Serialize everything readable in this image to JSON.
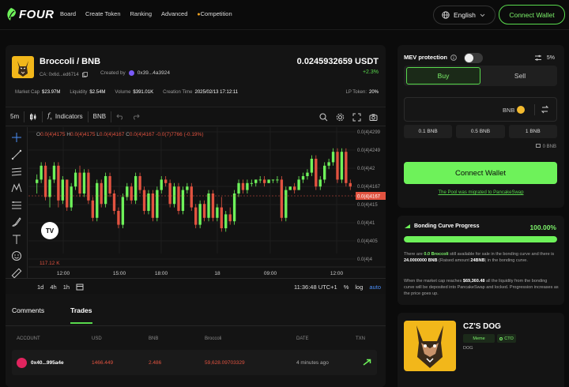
{
  "app": {
    "logo_text": "FOUR"
  },
  "nav": {
    "items": [
      "Board",
      "Create Token",
      "Ranking",
      "Advanced",
      "Competition"
    ]
  },
  "header": {
    "language": "English",
    "connect_wallet": "Connect Wallet"
  },
  "token": {
    "pair": "Broccoli / BNB",
    "ca_label": "CA: 0x6d...ed6714",
    "created_by_label": "Created by",
    "creator": "0x39...4a3924",
    "price": "0.0245932659 USDT",
    "change": "+2.3%",
    "stats": [
      {
        "label": "Market Cap",
        "value": "$23.97M"
      },
      {
        "label": "Liquidity",
        "value": "$2.54M"
      },
      {
        "label": "Volume",
        "value": "$391.01K"
      },
      {
        "label": "Creation Time",
        "value": "2025/02/13 17:12:11"
      }
    ],
    "lp_label": "LP Token:",
    "lp_value": "20%"
  },
  "chart_toolbar": {
    "interval": "5m",
    "indicators": "Indicators",
    "symbol": "BNB"
  },
  "chart_data": {
    "type": "candlestick",
    "ohlc_readout": {
      "o": "0.0(4)4175",
      "h": "0.0(4)4175",
      "l": "0.0(4)4167",
      "c": "0.0(4)4167",
      "chg": "-0.0(7)7766 (-0.19%)"
    },
    "y_tick_labels": [
      "0.0(4)4299",
      "0.0(4)4249",
      "0.0(4)42",
      "0.0(4)4167",
      "0.0(4)415",
      "0.0(4)41",
      "0.0(4)405",
      "0.0(4)4"
    ],
    "last_price_label": "0.0(4)4167",
    "x_tick_labels": [
      "12:00",
      "15:00",
      "18:00",
      "18",
      "09:00",
      "12:00"
    ],
    "volume_label": "117.12 K",
    "candles": [
      [
        4.18e-05,
        4.205e-05,
        4.15e-05,
        4.19e-05
      ],
      [
        4.19e-05,
        4.24e-05,
        4.18e-05,
        4.23e-05
      ],
      [
        4.23e-05,
        4.24e-05,
        4.13e-05,
        4.14e-05
      ],
      [
        4.14e-05,
        4.2e-05,
        4.11e-05,
        4.19e-05
      ],
      [
        4.19e-05,
        4.24e-05,
        4.18e-05,
        4.23e-05
      ],
      [
        4.23e-05,
        4.24e-05,
        4.11e-05,
        4.13e-05
      ],
      [
        4.13e-05,
        4.2e-05,
        4.12e-05,
        4.19e-05
      ],
      [
        4.19e-05,
        4.19e-05,
        4.1e-05,
        4.11e-05
      ],
      [
        4.11e-05,
        4.18e-05,
        4.1e-05,
        4.17e-05
      ],
      [
        4.17e-05,
        4.22e-05,
        4.16e-05,
        4.21e-05
      ],
      [
        4.21e-05,
        4.23e-05,
        4.14e-05,
        4.15e-05
      ],
      [
        4.15e-05,
        4.22e-05,
        4.14e-05,
        4.21e-05
      ],
      [
        4.21e-05,
        4.22e-05,
        4.12e-05,
        4.13e-05
      ],
      [
        4.13e-05,
        4.14e-05,
        4.07e-05,
        4.08e-05
      ],
      [
        4.08e-05,
        4.19e-05,
        4.07e-05,
        4.18e-05
      ],
      [
        4.18e-05,
        4.19e-05,
        4.11e-05,
        4.12e-05
      ],
      [
        4.12e-05,
        4.21e-05,
        4.11e-05,
        4.2e-05
      ],
      [
        4.2e-05,
        4.21e-05,
        4.14e-05,
        4.15e-05
      ],
      [
        4.15e-05,
        4.16e-05,
        4.09e-05,
        4.1e-05
      ],
      [
        4.1e-05,
        4.11e-05,
        4.05e-05,
        4.06e-05
      ],
      [
        4.06e-05,
        4.15e-05,
        4.05e-05,
        4.14e-05
      ],
      [
        4.14e-05,
        4.18e-05,
        4.13e-05,
        4.17e-05
      ],
      [
        4.17e-05,
        4.18e-05,
        4.12e-05,
        4.13e-05
      ],
      [
        4.13e-05,
        4.21e-05,
        4.12e-05,
        4.2e-05
      ],
      [
        4.2e-05,
        4.21e-05,
        4.15e-05,
        4.16e-05
      ],
      [
        4.16e-05,
        4.17e-05,
        4.09e-05,
        4.1e-05
      ],
      [
        4.1e-05,
        4.16e-05,
        4.09e-05,
        4.15e-05
      ],
      [
        4.15e-05,
        4.16e-05,
        4.07e-05,
        4.08e-05
      ],
      [
        4.08e-05,
        4.17e-05,
        4.07e-05,
        4.16e-05
      ],
      [
        4.16e-05,
        4.2e-05,
        4.15e-05,
        4.19e-05
      ],
      [
        4.19e-05,
        4.2e-05,
        4.17e-05,
        4.18e-05
      ],
      [
        4.18e-05,
        4.19e-05,
        4.11e-05,
        4.12e-05
      ],
      [
        4.12e-05,
        4.18e-05,
        4.11e-05,
        4.17e-05
      ],
      [
        4.17e-05,
        4.18e-05,
        4.09e-05,
        4.1e-05
      ],
      [
        4.1e-05,
        4.17e-05,
        4.09e-05,
        4.16e-05
      ],
      [
        4.16e-05,
        4.18e-05,
        4.15e-05,
        4.17e-05
      ],
      [
        4.17e-05,
        4.18e-05,
        4.1e-05,
        4.11e-05
      ],
      [
        4.11e-05,
        4.12e-05,
        4.05e-05,
        4.06e-05
      ],
      [
        4.06e-05,
        4.13e-05,
        4.05e-05,
        4.12e-05
      ],
      [
        4.12e-05,
        4.13e-05,
        4.07e-05,
        4.08e-05
      ],
      [
        4.08e-05,
        4.16e-05,
        4.07e-05,
        4.15e-05
      ],
      [
        4.15e-05,
        4.16e-05,
        4.07e-05,
        4.08e-05
      ],
      [
        4.08e-05,
        4.12e-05,
        4.07e-05,
        4.11e-05
      ],
      [
        4.11e-05,
        4.14e-05,
        4.04e-05,
        4.05e-05
      ],
      [
        4.05e-05,
        4.1e-05,
        4.04e-05,
        4.09e-05
      ],
      [
        4.09e-05,
        4.11e-05,
        4.06e-05,
        4.07e-05
      ],
      [
        4.07e-05,
        4.16e-05,
        4.06e-05,
        4.15e-05
      ],
      [
        4.15e-05,
        4.19e-05,
        4.14e-05,
        4.18e-05
      ],
      [
        4.18e-05,
        4.19e-05,
        4.15e-05,
        4.16e-05
      ],
      [
        4.16e-05,
        4.19e-05,
        4.15e-05,
        4.18e-05
      ],
      [
        4.18e-05,
        4.19e-05,
        4.17e-05,
        4.18e-05
      ],
      [
        4.18e-05,
        4.19e-05,
        4.17e-05,
        4.19e-05
      ],
      [
        4.19e-05,
        4.2e-05,
        4.18e-05,
        4.19e-05
      ],
      [
        4.19e-05,
        4.2e-05,
        4.17e-05,
        4.18e-05
      ],
      [
        4.18e-05,
        4.19e-05,
        4.18e-05,
        4.19e-05
      ],
      [
        4.19e-05,
        4.19e-05,
        4.18e-05,
        4.19e-05
      ],
      [
        4.19e-05,
        4.2e-05,
        4.18e-05,
        4.19e-05
      ],
      [
        4.19e-05,
        4.2e-05,
        4.07e-05,
        4.08e-05
      ],
      [
        4.08e-05,
        4.17e-05,
        4.07e-05,
        4.16e-05
      ],
      [
        4.16e-05,
        4.17e-05,
        4.16e-05,
        4.17e-05
      ],
      [
        4.17e-05,
        4.18e-05,
        4.15e-05,
        4.16e-05
      ],
      [
        4.16e-05,
        4.2e-05,
        4.16e-05,
        4.19e-05
      ],
      [
        4.19e-05,
        4.21e-05,
        4.18e-05,
        4.2e-05
      ],
      [
        4.2e-05,
        4.22e-05,
        4.19e-05,
        4.21e-05
      ],
      [
        4.21e-05,
        4.26e-05,
        4.2e-05,
        4.25e-05
      ],
      [
        4.25e-05,
        4.26e-05,
        4.16e-05,
        4.17e-05
      ],
      [
        4.17e-05,
        4.2e-05,
        4.16e-05,
        4.19e-05
      ],
      [
        4.19e-05,
        4.24e-05,
        4.18e-05,
        4.23e-05
      ],
      [
        4.23e-05,
        4.25e-05,
        4.22e-05,
        4.24e-05
      ],
      [
        4.24e-05,
        4.28e-05,
        4.23e-05,
        4.27e-05
      ],
      [
        4.27e-05,
        4.28e-05,
        4.18e-05,
        4.19e-05
      ],
      [
        4.19e-05,
        4.28e-05,
        4.18e-05,
        4.27e-05
      ],
      [
        4.27e-05,
        4.28e-05,
        4.17e-05,
        4.18e-05
      ],
      [
        4.18e-05,
        4.19e-05,
        4.16e-05,
        4.17e-05
      ]
    ],
    "ylim": [
      4e-05,
      4.3e-05
    ]
  },
  "chart_bottom": {
    "ranges": [
      "1d",
      "4h",
      "1h"
    ],
    "time": "11:36:48 UTC+1",
    "pct": "%",
    "log": "log",
    "auto": "auto"
  },
  "trades": {
    "tabs": [
      "Comments",
      "Trades"
    ],
    "columns": [
      "ACCOUNT",
      "USD",
      "BNB",
      "Broccoli",
      "DATE",
      "TXN"
    ],
    "rows": [
      {
        "account": "0x40...995a4e",
        "usd": "1466.449",
        "bnb": "2.486",
        "token": "59,628.09703329",
        "date": "4 minutes ago"
      }
    ]
  },
  "trade_panel": {
    "mev_label": "MEV protection",
    "slippage": "5%",
    "buy": "Buy",
    "sell": "Sell",
    "currency": "BNB",
    "presets": [
      "0.1 BNB",
      "0.5 BNB",
      "1 BNB"
    ],
    "balance": "0 BNB",
    "connect_wallet": "Connect Wallet",
    "migrated_text": "The Pool was migrated to PancakeSwap"
  },
  "bonding": {
    "title": "Bonding Curve Progress",
    "percent": "100.00%",
    "progress": 1.0,
    "p1_a": "There are",
    "p1_b": "0.0 Broccoli",
    "p1_c": "still available for sale in the bonding curve and there is",
    "p1_d": "24.0000000 BNB",
    "p1_e": "(Raised amount",
    "p1_f": "24BNB",
    "p1_g": ") in the bonding curve.",
    "p2_a": "When the market cap reaches",
    "p2_b": "$69,360.48",
    "p2_c": "all the liquidity from the bonding curve will be deposited into PancakeSwap and locked. Progression increases as the price goes up."
  },
  "related": {
    "name": "CZ'S DOG",
    "tag1": "Meme",
    "tag2": "CTO",
    "symbol": "DOG"
  },
  "colors": {
    "accent": "#6ef25a",
    "up": "#59d94d",
    "down": "#e25340",
    "background": "#0b0b0b",
    "panel": "#141414"
  }
}
